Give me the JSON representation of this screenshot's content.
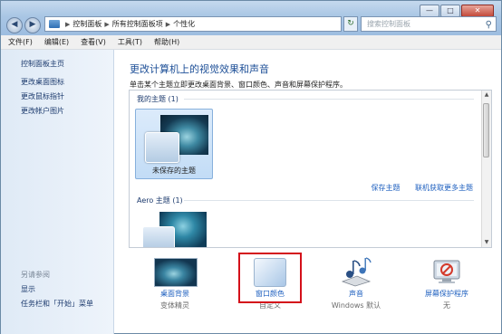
{
  "window": {
    "controls": {
      "minimize": "—",
      "maximize": "□",
      "close": "✕"
    }
  },
  "address_bar": {
    "crumbs": [
      "控制面板",
      "所有控制面板项",
      "个性化"
    ],
    "search_placeholder": "搜索控制面板"
  },
  "menu": [
    "文件(F)",
    "编辑(E)",
    "查看(V)",
    "工具(T)",
    "帮助(H)"
  ],
  "left_pane": {
    "home_link": "控制面板主页",
    "links": [
      "更改桌面图标",
      "更改鼠标指针",
      "更改帐户图片"
    ],
    "see_also_heading": "另请参阅",
    "see_also": [
      "显示",
      "任务栏和「开始」菜单"
    ]
  },
  "main": {
    "title": "更改计算机上的视觉效果和声音",
    "description": "单击某个主题立即更改桌面背景、窗口颜色、声音和屏幕保护程序。",
    "groups": [
      {
        "label": "我的主题 (1)",
        "themes": [
          {
            "name": "未保存的主题",
            "selected": true
          }
        ]
      },
      {
        "label": "Aero 主题 (1)"
      }
    ],
    "actions": [
      "保存主题",
      "联机获取更多主题"
    ]
  },
  "bottom": [
    {
      "label": "桌面背景",
      "sub": "变体精灵",
      "icon": "desktop-background-icon"
    },
    {
      "label": "窗口颜色",
      "sub": "自定义",
      "icon": "window-color-icon",
      "highlighted": true
    },
    {
      "label": "声音",
      "sub": "Windows 默认",
      "icon": "sound-icon"
    },
    {
      "label": "屏幕保护程序",
      "sub": "无",
      "icon": "screensaver-icon"
    }
  ],
  "colors": {
    "link": "#1d5fbf",
    "title": "#1d4f97",
    "highlight_border": "#d4101a"
  }
}
